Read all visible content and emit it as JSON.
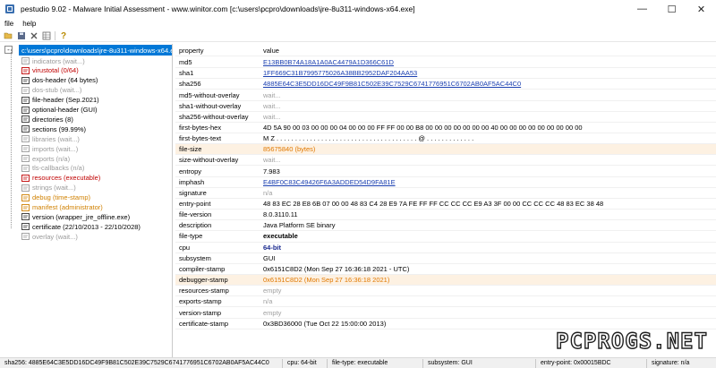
{
  "window": {
    "title": "pestudio 9.02 - Malware Initial Assessment - www.winitor.com [c:\\users\\pcpro\\downloads\\jre-8u311-windows-x64.exe]",
    "minimize_glyph": "—",
    "maximize_glyph": "☐",
    "close_glyph": "✕"
  },
  "menu": {
    "file": "file",
    "help": "help"
  },
  "toolbar": {
    "icons": [
      "open-icon",
      "save-icon",
      "close-icon",
      "grid-icon",
      "info-icon"
    ]
  },
  "tree": {
    "expander": "-",
    "root": "c:\\users\\pcpro\\downloads\\jre-8u311-windows-x64.exe",
    "items": [
      {
        "label": "indicators (wait...)",
        "style": "gray",
        "icon": "indicators-icon"
      },
      {
        "label": "virustotal (0/64)",
        "style": "red",
        "icon": "virustotal-icon"
      },
      {
        "label": "dos-header (64 bytes)",
        "style": "black",
        "icon": "dos-header-icon"
      },
      {
        "label": "dos-stub (wait...)",
        "style": "gray",
        "icon": "dos-stub-icon"
      },
      {
        "label": "file-header (Sep.2021)",
        "style": "black",
        "icon": "file-header-icon"
      },
      {
        "label": "optional-header (GUI)",
        "style": "black",
        "icon": "optional-header-icon"
      },
      {
        "label": "directories (8)",
        "style": "black",
        "icon": "directories-icon"
      },
      {
        "label": "sections (99.99%)",
        "style": "black",
        "icon": "sections-icon"
      },
      {
        "label": "libraries (wait...)",
        "style": "gray",
        "icon": "libraries-icon"
      },
      {
        "label": "imports (wait...)",
        "style": "gray",
        "icon": "imports-icon"
      },
      {
        "label": "exports (n/a)",
        "style": "gray",
        "icon": "exports-icon"
      },
      {
        "label": "tls-callbacks (n/a)",
        "style": "gray",
        "icon": "tls-callbacks-icon"
      },
      {
        "label": "resources (executable)",
        "style": "red",
        "icon": "resources-icon"
      },
      {
        "label": "strings (wait...)",
        "style": "gray",
        "icon": "strings-icon"
      },
      {
        "label": "debug (time-stamp)",
        "style": "orange",
        "icon": "debug-icon"
      },
      {
        "label": "manifest (administrator)",
        "style": "orange",
        "icon": "manifest-icon"
      },
      {
        "label": "version (wrapper_jre_offline.exe)",
        "style": "black",
        "icon": "version-icon"
      },
      {
        "label": "certificate (22/10/2013 - 22/10/2028)",
        "style": "black",
        "icon": "certificate-icon"
      },
      {
        "label": "overlay (wait...)",
        "style": "gray",
        "icon": "overlay-icon"
      }
    ]
  },
  "table": {
    "header": {
      "property": "property",
      "value": "value"
    },
    "rows": [
      {
        "property": "md5",
        "value": "E13BB0B74A18A1A0AC4479A1D366C61D",
        "style": "link"
      },
      {
        "property": "sha1",
        "value": "1FF669C31B7995775026A38BB2952DAF204AA53",
        "style": "link"
      },
      {
        "property": "sha256",
        "value": "4885E64C3E5DD16DC49F9B81C502E39C7529C6741776951C6702AB0AF5AC44C0",
        "style": "link"
      },
      {
        "property": "md5-without-overlay",
        "value": "wait...",
        "style": "waiting"
      },
      {
        "property": "sha1-without-overlay",
        "value": "wait...",
        "style": "waiting"
      },
      {
        "property": "sha256-without-overlay",
        "value": "wait...",
        "style": "waiting"
      },
      {
        "property": "first-bytes-hex",
        "value": "4D 5A 90 00 03 00 00 00 04 00 00 00 FF FF 00 00 B8 00 00 00 00 00 00 00 40 00 00 00 00 00 00 00 00 00",
        "style": "normal"
      },
      {
        "property": "first-bytes-text",
        "value": "M Z . . . . . . . . . . . . . . . . . . . . . . . . . . . . . . . . . . . . . . @ . . . . . . . . . . . . .",
        "style": "normal"
      },
      {
        "property": "file-size",
        "value": "85675840 (bytes)",
        "style": "orange-hl"
      },
      {
        "property": "size-without-overlay",
        "value": "wait...",
        "style": "waiting"
      },
      {
        "property": "entropy",
        "value": "7.983",
        "style": "normal"
      },
      {
        "property": "imphash",
        "value": "E4BF0C83C49426F6A3ADDED54D9FA81E",
        "style": "link"
      },
      {
        "property": "signature",
        "value": "n/a",
        "style": "waiting"
      },
      {
        "property": "entry-point",
        "value": "48 83 EC 28 E8 6B 07 00 00 48 83 C4 28 E9 7A FE FF FF CC CC CC E9 A3 3F 00 00 CC CC CC 48 83 EC 38 48",
        "style": "normal"
      },
      {
        "property": "file-version",
        "value": "8.0.3110.11",
        "style": "normal"
      },
      {
        "property": "description",
        "value": "Java Platform SE binary",
        "style": "normal"
      },
      {
        "property": "file-type",
        "value": "executable",
        "style": "bold"
      },
      {
        "property": "cpu",
        "value": "64-bit",
        "style": "bold-navy"
      },
      {
        "property": "subsystem",
        "value": "GUI",
        "style": "normal"
      },
      {
        "property": "compiler-stamp",
        "value": "0x6151C8D2 (Mon Sep 27 16:36:18 2021 - UTC)",
        "style": "normal"
      },
      {
        "property": "debugger-stamp",
        "value": "0x6151C8D2 (Mon Sep 27 16:36:18 2021)",
        "style": "orange-hl"
      },
      {
        "property": "resources-stamp",
        "value": "empty",
        "style": "waiting"
      },
      {
        "property": "exports-stamp",
        "value": "n/a",
        "style": "waiting"
      },
      {
        "property": "version-stamp",
        "value": "empty",
        "style": "waiting"
      },
      {
        "property": "certificate-stamp",
        "value": "0x3BD36000 (Tue Oct 22 15:00:00 2013)",
        "style": "normal"
      }
    ]
  },
  "statusbar": {
    "sha256": "sha256: 4885E64C3E5DD16DC49F9B81C502E39C7529C6741776951C6702AB0AF5AC44C0",
    "cpu": "cpu: 64-bit",
    "file_type": "file-type: executable",
    "subsystem": "subsystem: GUI",
    "entry_point": "entry-point: 0x00015BDC",
    "signature": "signature: n/a"
  },
  "watermark": {
    "text": "PCPROGS.NET"
  },
  "colors": {
    "selection": "#0078d7",
    "link": "#1a3fb0",
    "orange": "#e07800",
    "red": "#c00000",
    "navy": "#1a2a8f",
    "highlight": "#fdf1e2"
  }
}
